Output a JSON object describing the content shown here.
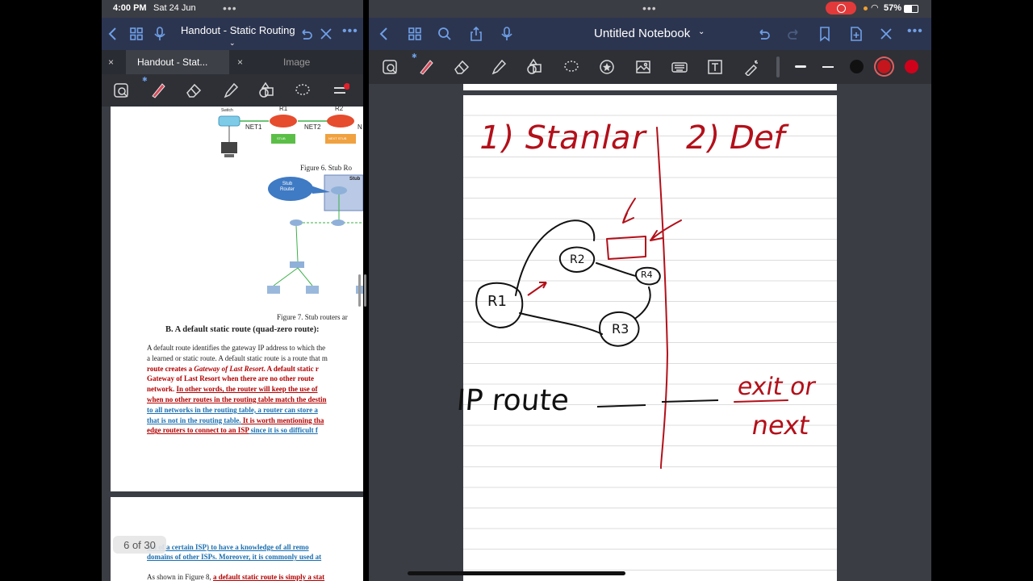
{
  "status": {
    "time": "4:00 PM",
    "date": "Sat 24 Jun",
    "battery": "57%"
  },
  "left_app": {
    "doc_title": "Handout - Static Routing",
    "tabs": [
      {
        "label": "Handout - Stat..."
      },
      {
        "label": "Image"
      }
    ],
    "figure6": {
      "switch_label": "Switch",
      "r1_label": "R1",
      "r2_label": "R2",
      "net1": "NET1",
      "net2": "NET2",
      "net_trunc": "N",
      "stub_badge": "STUB",
      "next_badge": "NEXT STUB",
      "caption": "Figure 6. Stub Ro"
    },
    "figure7": {
      "stub_bubble": "Stub\nRouter",
      "stub_box": "Stub",
      "caption": "Figure 7. Stub routers ar"
    },
    "section_heading": "B.  A default static route (quad-zero route):",
    "para_lines": [
      [
        {
          "t": "A default route identifies the gateway IP address to which the",
          "s": ""
        }
      ],
      [
        {
          "t": "a learned or static route. A default static route is a route that m",
          "s": ""
        }
      ],
      [
        {
          "t": "route creates a ",
          "s": "red"
        },
        {
          "t": "Gateway of Last Resort",
          "s": "red-italic"
        },
        {
          "t": ". A default static r",
          "s": "red"
        }
      ],
      [
        {
          "t": "Gateway of Last Resort when there are no other route",
          "s": "red"
        }
      ],
      [
        {
          "t": "network. ",
          "s": "red"
        },
        {
          "t": "In other words, the router will keep the use of",
          "s": "redu"
        }
      ],
      [
        {
          "t": "when no other routes in the routing table match the destin",
          "s": "redu"
        }
      ],
      [
        {
          "t": "to all networks in the routing table, a router can store a",
          "s": "blue"
        }
      ],
      [
        {
          "t": "that is not in the routing table.",
          "s": "blue"
        },
        {
          "t": "  It is worth mentioning tha",
          "s": "redu"
        }
      ],
      [
        {
          "t": "edge routers to connect to an ISP",
          "s": "redu"
        },
        {
          "t": " since it is so difficult f",
          "s": "blue"
        }
      ]
    ],
    "page2_lines": [
      [
        {
          "t": "ain of a certain ISP) to have a knowledge of all remo",
          "s": "blue"
        }
      ],
      [
        {
          "t": "domains of other ISPs. Moreover, it is commonly used at",
          "s": "blue"
        }
      ],
      [
        {
          "t": "",
          "s": ""
        }
      ],
      [
        {
          "t": "As shown in Figure 8, ",
          "s": ""
        },
        {
          "t": "a default static route is simply a stat",
          "s": "redu"
        }
      ]
    ],
    "page_indicator": "6 of 30"
  },
  "right_app": {
    "notebook_title": "Untitled Notebook",
    "pen_colors": [
      "#111111",
      "#c4161c",
      "#d0021b"
    ],
    "selected_color_index": 1
  },
  "handwriting": {
    "heading_left": "1) Stanlar",
    "heading_right": "2) Def",
    "r1": "R1",
    "r2": "R2",
    "r3": "R3",
    "r4": "R4",
    "ip_route": "IP route",
    "exit": "exit or",
    "next": "next"
  }
}
